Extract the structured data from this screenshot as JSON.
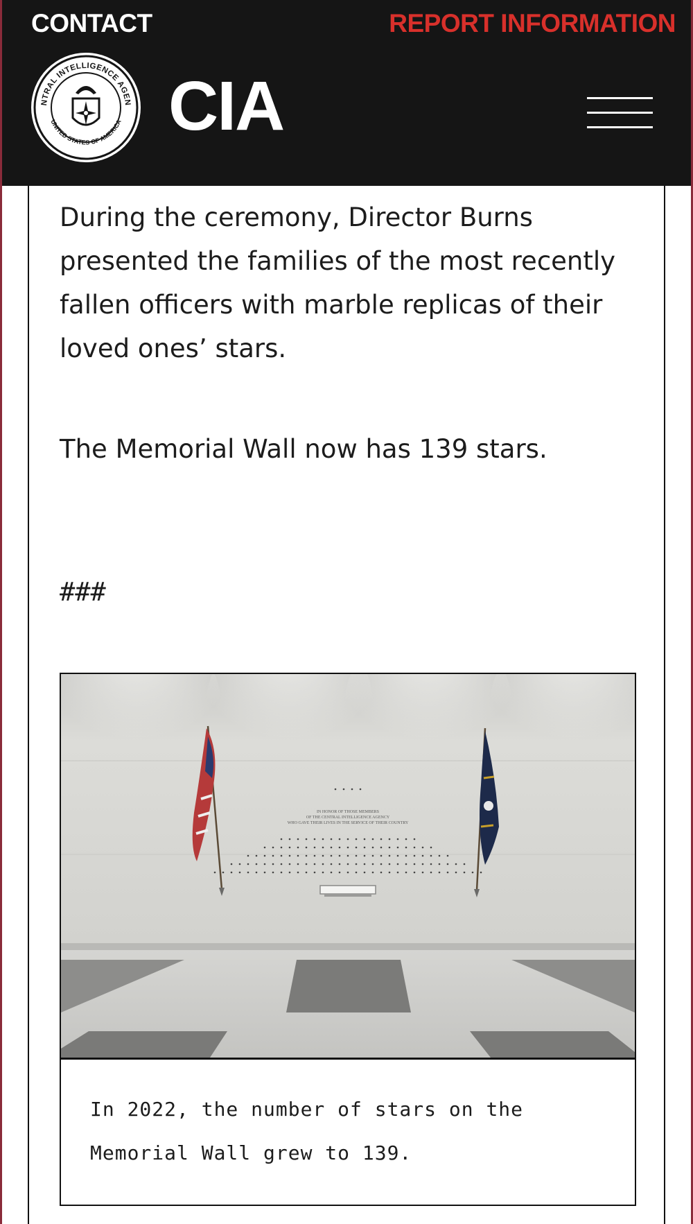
{
  "header": {
    "contact_label": "CONTACT",
    "report_label": "REPORT INFORMATION",
    "brand_name": "CIA",
    "seal": {
      "top_text": "CENTRAL INTELLIGENCE AGENCY",
      "bottom_text": "UNITED STATES OF AMERICA"
    },
    "menu_icon": "hamburger-menu-icon"
  },
  "article": {
    "paragraph_1": "During the ceremony, Director Burns presented the families of the most recently fallen officers with marble replicas of their loved ones’ stars.",
    "paragraph_2": "The Memorial Wall now has 139 stars.",
    "end_marker": "###"
  },
  "figure": {
    "wall_inscription": [
      "IN HONOR OF THOSE MEMBERS",
      "OF THE CENTRAL INTELLIGENCE AGENCY",
      "WHO GAVE THEIR LIVES IN THE SERVICE OF THEIR COUNTRY"
    ],
    "caption": "In 2022, the number of stars on the Memorial Wall grew to 139."
  },
  "colors": {
    "header_bg": "#151515",
    "report_red": "#d8302b",
    "frame_maroon": "#8a2b3a"
  }
}
